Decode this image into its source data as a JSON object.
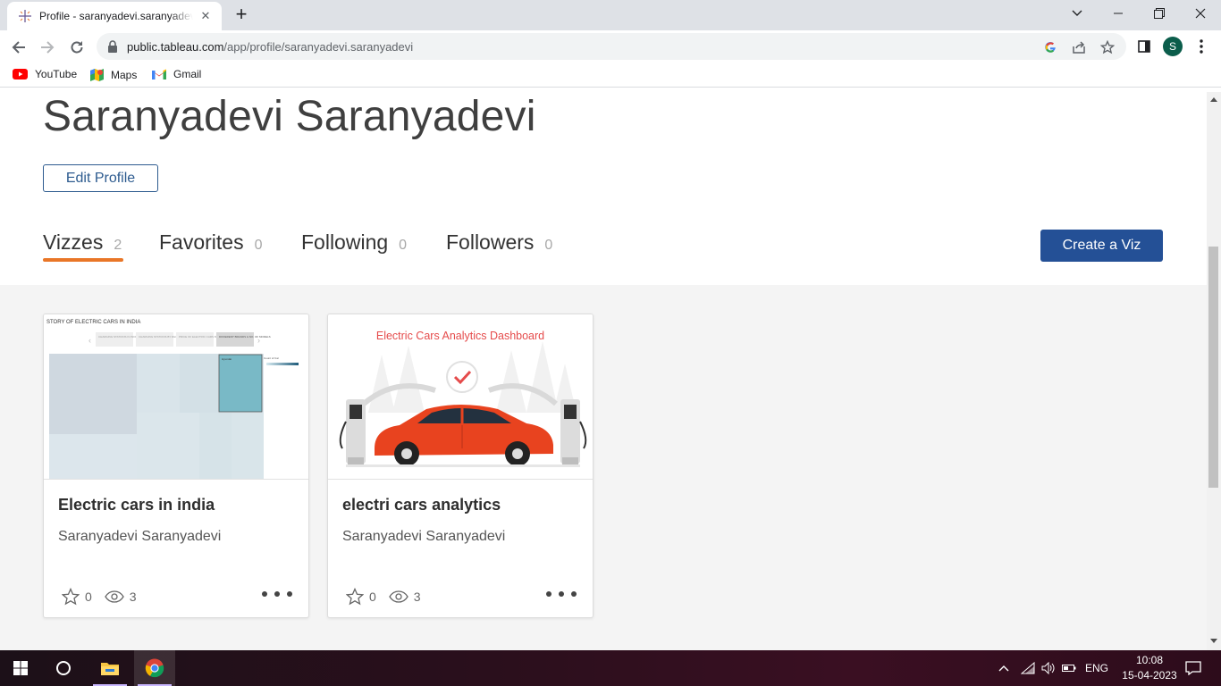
{
  "browser": {
    "tab_title": "Profile - saranyadevi.saranyadevi",
    "url_host": "public.tableau.com",
    "url_path": "/app/profile/saranyadevi.saranyadevi",
    "avatar_letter": "S",
    "bookmarks": [
      {
        "label": "YouTube",
        "icon": "youtube-icon"
      },
      {
        "label": "Maps",
        "icon": "maps-icon"
      },
      {
        "label": "Gmail",
        "icon": "gmail-icon"
      }
    ]
  },
  "profile": {
    "name": "Saranyadevi Saranyadevi",
    "edit_label": "Edit Profile",
    "tabs": [
      {
        "label": "Vizzes",
        "count": "2"
      },
      {
        "label": "Favorites",
        "count": "0"
      },
      {
        "label": "Following",
        "count": "0"
      },
      {
        "label": "Followers",
        "count": "0"
      }
    ],
    "create_label": "Create a Viz",
    "accent_color": "#e97627",
    "button_color": "#245096"
  },
  "vizzes": [
    {
      "title": "Electric cars in india",
      "author": "Saranyadevi Saranyadevi",
      "favorites": "0",
      "views": "3",
      "thumb_heading": "STORY OF ELECTRIC CARS IN INDIA",
      "thumb_tabs": [
        "CHARGING STATIONS IN INDIA",
        "CHARGING STATIONS BY REGION & TYPE",
        "PRICE OF ELECTRIC CARS BY DIFFERENT BRANDS",
        "DIFFERENT BRANDS & NO. OF MODELS"
      ],
      "thumb_highlight": "Hyundai",
      "thumb_legend": "Count of Car"
    },
    {
      "title": "electri cars analytics",
      "author": "Saranyadevi Saranyadevi",
      "favorites": "0",
      "views": "3",
      "thumb_heading": "Electric Cars Analytics Dashboard"
    }
  ],
  "taskbar": {
    "language": "ENG",
    "time": "10:08",
    "date": "15-04-2023"
  }
}
